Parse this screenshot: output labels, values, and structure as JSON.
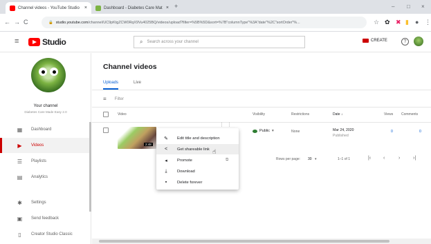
{
  "browser": {
    "tabs": [
      {
        "title": "Channel videos - YouTube Studio",
        "active": true,
        "favicon_color": "#ff0000"
      },
      {
        "title": "Dashboard - Diabetes Care Mat",
        "active": false,
        "favicon_color": "#7cb342"
      }
    ],
    "new_tab": "+",
    "controls": {
      "minimize": "–",
      "maximize": "□",
      "close": "×"
    },
    "url_domain": "studio.youtube.com",
    "url_path": "/channel/UC9pKtgZCW0RqX9Vu4025BQ/videos/upload?filter=%5B%5D&sort=%7B\"columnType\"%3A\"date\"%2C\"sortOrder\"%..."
  },
  "header": {
    "logo_text": "Studio",
    "search_placeholder": "Search across your channel",
    "create_label": "CREATE",
    "help_glyph": "?"
  },
  "sidebar": {
    "your_channel": "Your channel",
    "channel_name": "Diabetes Care Made Easy 2.0",
    "items": [
      {
        "label": "Dashboard",
        "icon": "dashboard-icon",
        "active": false
      },
      {
        "label": "Videos",
        "icon": "videos-icon",
        "active": true
      },
      {
        "label": "Playlists",
        "icon": "playlists-icon",
        "active": false
      },
      {
        "label": "Analytics",
        "icon": "analytics-icon",
        "active": false
      },
      {
        "label": "Settings",
        "icon": "settings-icon",
        "active": false
      },
      {
        "label": "Send feedback",
        "icon": "feedback-icon",
        "active": false
      },
      {
        "label": "Creator Studio Classic",
        "icon": "classic-icon",
        "active": false
      }
    ]
  },
  "main": {
    "title": "Channel videos",
    "tabs": [
      {
        "label": "Uploads",
        "active": true
      },
      {
        "label": "Live",
        "active": false
      }
    ],
    "filter_placeholder": "Filter",
    "columns": {
      "video": "Video",
      "visibility": "Visibility",
      "restrictions": "Restrictions",
      "date": "Date ↓",
      "views": "Views",
      "comments": "Comments"
    },
    "row": {
      "duration": "2:48",
      "visibility": "Public",
      "restrictions": "None",
      "date": "Mar 24, 2020",
      "date_status": "Published",
      "views": "0",
      "comments": "0"
    },
    "pager": {
      "rows_per_page_label": "Rows per page:",
      "rows_per_page_value": "30",
      "range": "1–1 of 1"
    }
  },
  "context_menu": {
    "items": [
      {
        "label": "Edit title and description",
        "icon": "pencil-icon"
      },
      {
        "label": "Get shareable link",
        "icon": "share-icon",
        "hover": true
      },
      {
        "label": "Promote",
        "icon": "promote-icon"
      },
      {
        "label": "Download",
        "icon": "download-icon"
      },
      {
        "label": "Delete forever",
        "icon": "trash-icon"
      }
    ]
  }
}
